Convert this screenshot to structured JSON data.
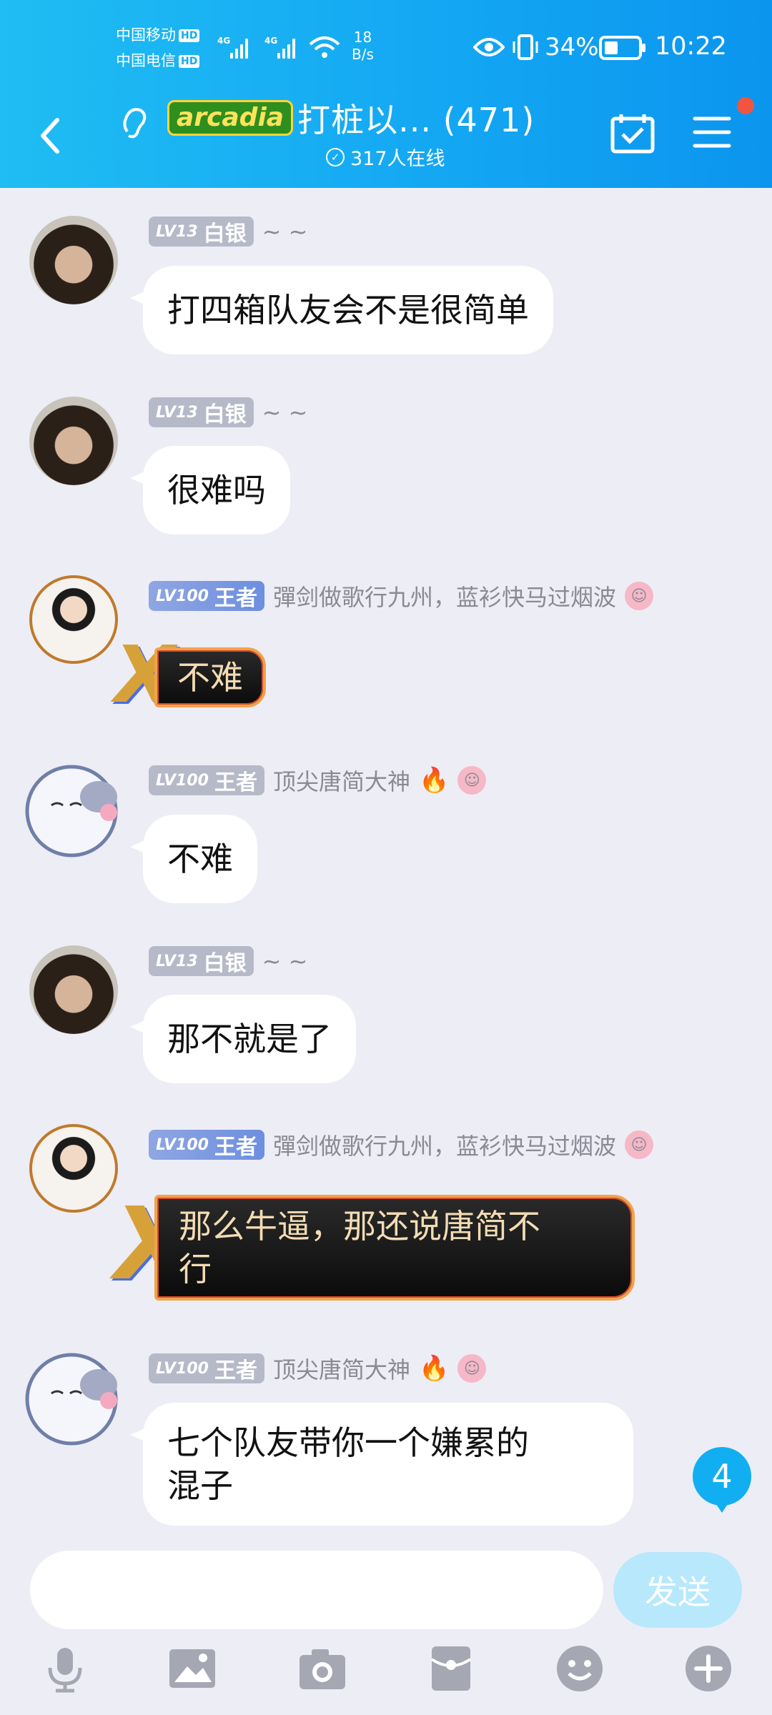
{
  "status_bar": {
    "carrier1": "中国移动",
    "carrier2": "中国电信",
    "hd": "HD",
    "net": "4G",
    "speed_value": "18",
    "speed_unit": "B/s",
    "battery": "34%",
    "time": "10:22"
  },
  "header": {
    "back_icon": "chevron-left-icon",
    "ear_icon": "ear-icon",
    "logo_text": "arcadia",
    "title": "打桩以... (471)",
    "online": "317人在线",
    "calendar_icon": "calendar-check-icon",
    "menu_icon": "menu-icon"
  },
  "messages": [
    {
      "level": "LV13",
      "rank": "白银",
      "nick": "~ ~",
      "text": "打四箱队友会不是很简单"
    },
    {
      "level": "LV13",
      "rank": "白银",
      "nick": "~ ~",
      "text": "很难吗"
    },
    {
      "level": "LV100",
      "rank": "王者",
      "nick": "彈剑做歌行九州，蓝衫快马过烟波",
      "text": "不难"
    },
    {
      "level": "LV100",
      "rank": "王者",
      "nick": "顶尖唐简大神",
      "text": "不难"
    },
    {
      "level": "LV13",
      "rank": "白银",
      "nick": "~ ~",
      "text": "那不就是了"
    },
    {
      "level": "LV100",
      "rank": "王者",
      "nick": "彈剑做歌行九州，蓝衫快马过烟波",
      "text": "那么牛逼，那还说唐简不\n行"
    },
    {
      "level": "LV100",
      "rank": "王者",
      "nick": "顶尖唐简大神",
      "text": "七个队友带你一个嫌累的\n混子"
    }
  ],
  "unread_count": "4",
  "composer": {
    "send": "发送"
  },
  "toolbar": [
    "microphone-icon",
    "image-icon",
    "camera-icon",
    "red-packet-icon",
    "emoji-icon",
    "plus-icon"
  ]
}
